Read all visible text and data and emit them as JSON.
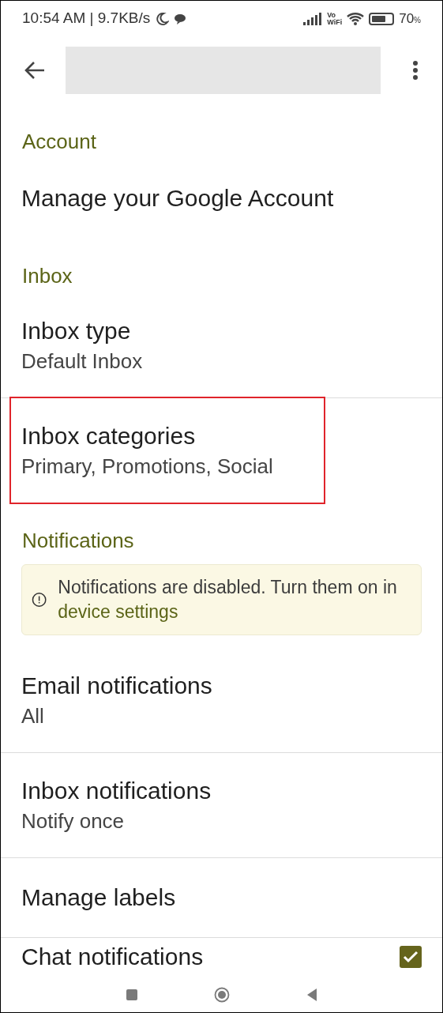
{
  "status_bar": {
    "time": "10:54 AM | 9.7KB/s",
    "network_label": "Vo\nWiFi",
    "battery": "70",
    "battery_unit": "%"
  },
  "entries": [
    {
      "kind": "header",
      "title": "Account"
    },
    {
      "kind": "item",
      "title": "Manage your Google Account",
      "divider": false,
      "highlighted": false
    },
    {
      "kind": "header",
      "title": "Inbox"
    },
    {
      "kind": "item",
      "title": "Inbox type",
      "subtitle": "Default Inbox",
      "divider": true,
      "highlighted": false
    },
    {
      "kind": "item",
      "title": "Inbox categories",
      "subtitle": "Primary, Promotions, Social",
      "divider": false,
      "highlighted": true
    },
    {
      "kind": "header",
      "title": "Notifications"
    },
    {
      "kind": "banner",
      "text": "Notifications are disabled. Turn them on in",
      "link": "device settings"
    },
    {
      "kind": "item",
      "title": "Email notifications",
      "subtitle": "All",
      "divider": true,
      "highlighted": false
    },
    {
      "kind": "item",
      "title": "Inbox notifications",
      "subtitle": "Notify once",
      "divider": true,
      "highlighted": false
    },
    {
      "kind": "item",
      "title": "Manage labels",
      "divider": true,
      "highlighted": false
    },
    {
      "kind": "checkbox",
      "title": "Chat notifications",
      "checked": true
    }
  ]
}
